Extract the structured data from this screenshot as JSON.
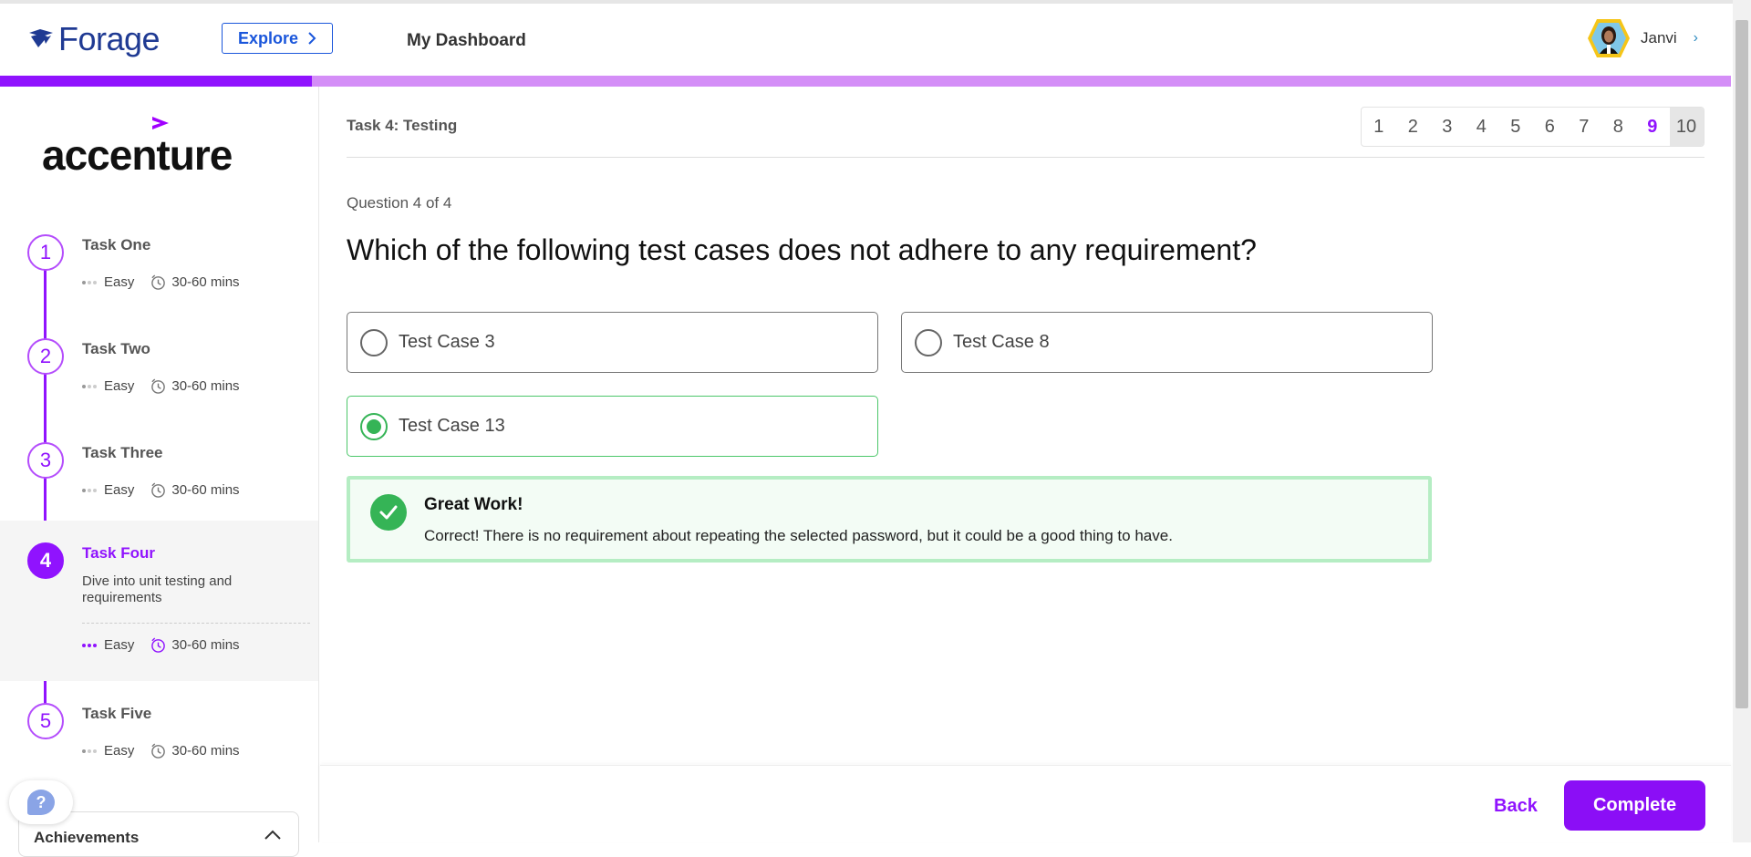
{
  "header": {
    "logo_text": "Forage",
    "explore_label": "Explore",
    "dashboard_label": "My Dashboard",
    "user_name": "Janvi"
  },
  "progress": {
    "fraction": 0.18
  },
  "sidebar": {
    "company": "accenture",
    "tasks": [
      {
        "number": "1",
        "title": "Task One",
        "difficulty": "Easy",
        "duration": "30-60 mins"
      },
      {
        "number": "2",
        "title": "Task Two",
        "difficulty": "Easy",
        "duration": "30-60 mins"
      },
      {
        "number": "3",
        "title": "Task Three",
        "difficulty": "Easy",
        "duration": "30-60 mins"
      },
      {
        "number": "4",
        "title": "Task Four",
        "description": "Dive into unit testing and requirements",
        "difficulty": "Easy",
        "duration": "30-60 mins"
      },
      {
        "number": "5",
        "title": "Task Five",
        "difficulty": "Easy",
        "duration": "30-60 mins"
      }
    ],
    "help_label": "?",
    "achievements_label": "Achievements"
  },
  "main": {
    "task_title": "Task 4: Testing",
    "pages": [
      "1",
      "2",
      "3",
      "4",
      "5",
      "6",
      "7",
      "8",
      "9",
      "10"
    ],
    "current_page": "9",
    "selected_page": "10",
    "question_count": "Question 4 of 4",
    "question": "Which of the following test cases does not adhere to any requirement?",
    "options": [
      "Test Case 3",
      "Test Case 8",
      "Test Case 13"
    ],
    "selected_option": "Test Case 13",
    "feedback": {
      "title": "Great Work!",
      "text": "Correct! There is no requirement about repeating the selected password, but it could be a good thing to have."
    }
  },
  "footer": {
    "back_label": "Back",
    "complete_label": "Complete"
  },
  "colors": {
    "brand_purple": "#9013fe",
    "progress_track": "#d48ef7",
    "correct_green": "#35b456",
    "feedback_border": "#b5edc3",
    "forage_blue": "#1f3a93"
  }
}
